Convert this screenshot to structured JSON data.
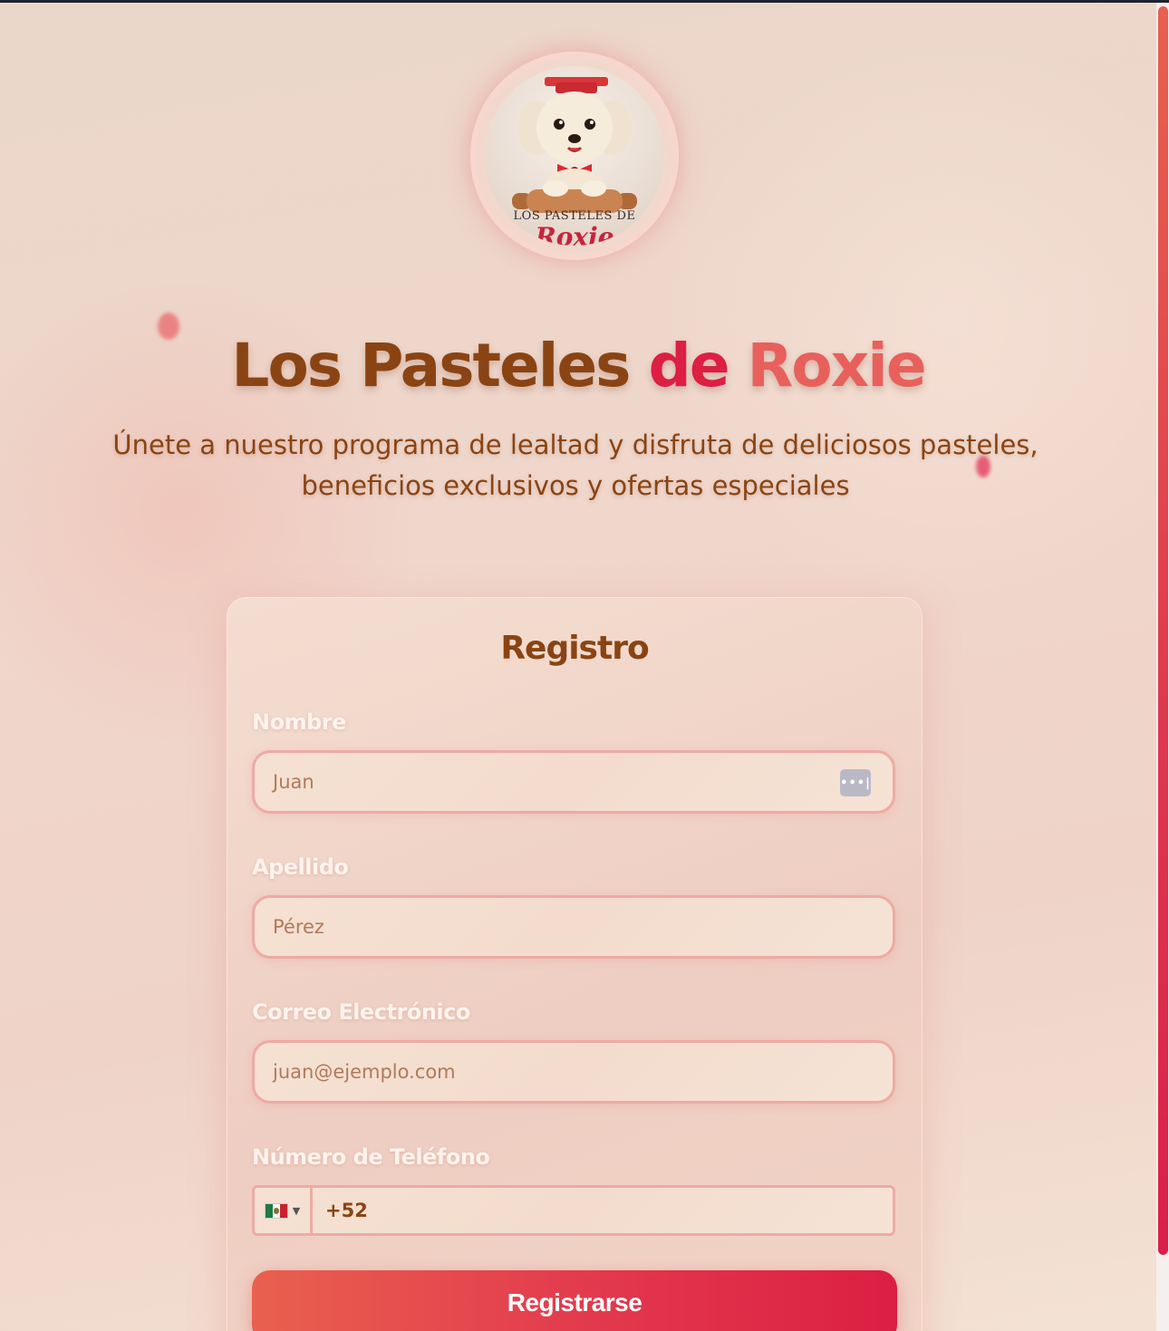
{
  "brand": {
    "logo_text_top": "LOS PASTELES DE",
    "logo_text_script": "Roxie",
    "title_part1": "Los Pasteles",
    "title_part2": "de",
    "title_part3": "Roxie",
    "subtitle": "Únete a nuestro programa de lealtad y disfruta de deliciosos pasteles, beneficios exclusivos y ofertas especiales"
  },
  "form": {
    "title": "Registro",
    "fields": [
      {
        "label": "Nombre",
        "placeholder": "Juan",
        "value": ""
      },
      {
        "label": "Apellido",
        "placeholder": "Pérez",
        "value": ""
      },
      {
        "label": "Correo Electrónico",
        "placeholder": "juan@ejemplo.com",
        "value": ""
      }
    ],
    "phone": {
      "label": "Número de Teléfono",
      "country": "MX",
      "country_icon": "mexico-flag-icon",
      "value": "+52"
    },
    "submit_label": "Registrarse"
  },
  "colors": {
    "brown": "#8a4413",
    "crimson": "#dc1f43",
    "coral": "#e8605c",
    "input_border": "#eeaaa3"
  }
}
